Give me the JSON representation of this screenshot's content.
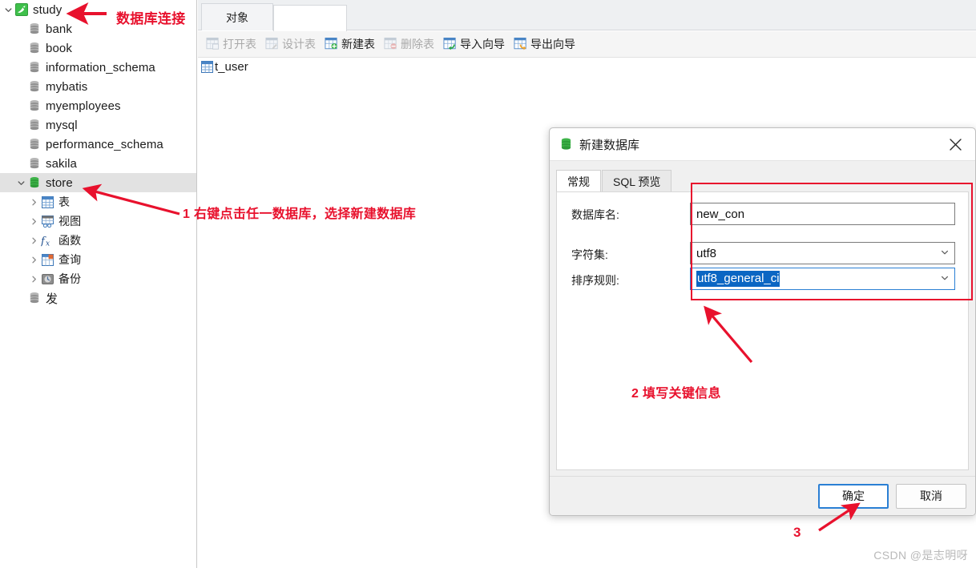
{
  "colors": {
    "annotation_red": "#e8112d",
    "db_icon_gray": "#8e8e8e",
    "db_icon_green": "#2eaf3e",
    "accent_blue": "#2a7fd4",
    "selection_blue": "#0b66c3",
    "tree_selection_gray": "#e2e2e2"
  },
  "sidebar": {
    "connection": {
      "label": "study",
      "icon": "mysql-connection-icon",
      "expanded": true
    },
    "databases": [
      {
        "label": "bank",
        "icon": "database-icon",
        "state": "closed"
      },
      {
        "label": "book",
        "icon": "database-icon",
        "state": "closed"
      },
      {
        "label": "information_schema",
        "icon": "database-icon",
        "state": "closed"
      },
      {
        "label": "mybatis",
        "icon": "database-icon",
        "state": "closed"
      },
      {
        "label": "myemployees",
        "icon": "database-icon",
        "state": "closed"
      },
      {
        "label": "mysql",
        "icon": "database-icon",
        "state": "closed"
      },
      {
        "label": "performance_schema",
        "icon": "database-icon",
        "state": "closed"
      },
      {
        "label": "sakila",
        "icon": "database-icon",
        "state": "closed"
      },
      {
        "label": "store",
        "icon": "database-open-icon",
        "state": "open",
        "selected": true,
        "expanded": true
      },
      {
        "label": "发",
        "icon": "database-icon",
        "state": "closed"
      }
    ],
    "store_children": [
      {
        "label": "表",
        "icon": "table-icon"
      },
      {
        "label": "视图",
        "icon": "view-icon"
      },
      {
        "label": "函数",
        "icon": "function-icon"
      },
      {
        "label": "查询",
        "icon": "query-icon"
      },
      {
        "label": "备份",
        "icon": "backup-icon"
      }
    ]
  },
  "main": {
    "tab": {
      "label": "对象"
    },
    "toolbar": [
      {
        "label": "打开表",
        "icon": "open-table-icon",
        "enabled": false
      },
      {
        "label": "设计表",
        "icon": "design-table-icon",
        "enabled": false
      },
      {
        "label": "新建表",
        "icon": "new-table-icon",
        "enabled": true
      },
      {
        "label": "删除表",
        "icon": "delete-table-icon",
        "enabled": false
      },
      {
        "label": "导入向导",
        "icon": "import-wizard-icon",
        "enabled": true
      },
      {
        "label": "导出向导",
        "icon": "export-wizard-icon",
        "enabled": true
      }
    ],
    "objects": [
      {
        "label": "t_user",
        "icon": "table-icon"
      }
    ]
  },
  "dialog": {
    "title": "新建数据库",
    "title_icon": "database-icon",
    "close_glyph": "✕",
    "tabs": [
      {
        "label": "常规",
        "active": true
      },
      {
        "label": "SQL 预览",
        "active": false
      }
    ],
    "fields": {
      "db_name": {
        "label": "数据库名:",
        "value": "new_con",
        "placeholder": ""
      },
      "charset": {
        "label": "字符集:",
        "value": "utf8"
      },
      "collation": {
        "label": "排序规则:",
        "value": "utf8_general_ci",
        "focused": true,
        "text_selected": true
      }
    },
    "buttons": {
      "ok": "确定",
      "cancel": "取消"
    }
  },
  "annotations": {
    "connection_note": "数据库连接",
    "step1": "1 右键点击任一数据库，选择新建数据库",
    "step2": "2 填写关键信息",
    "step3": "3"
  },
  "watermark": "CSDN @是志明呀"
}
